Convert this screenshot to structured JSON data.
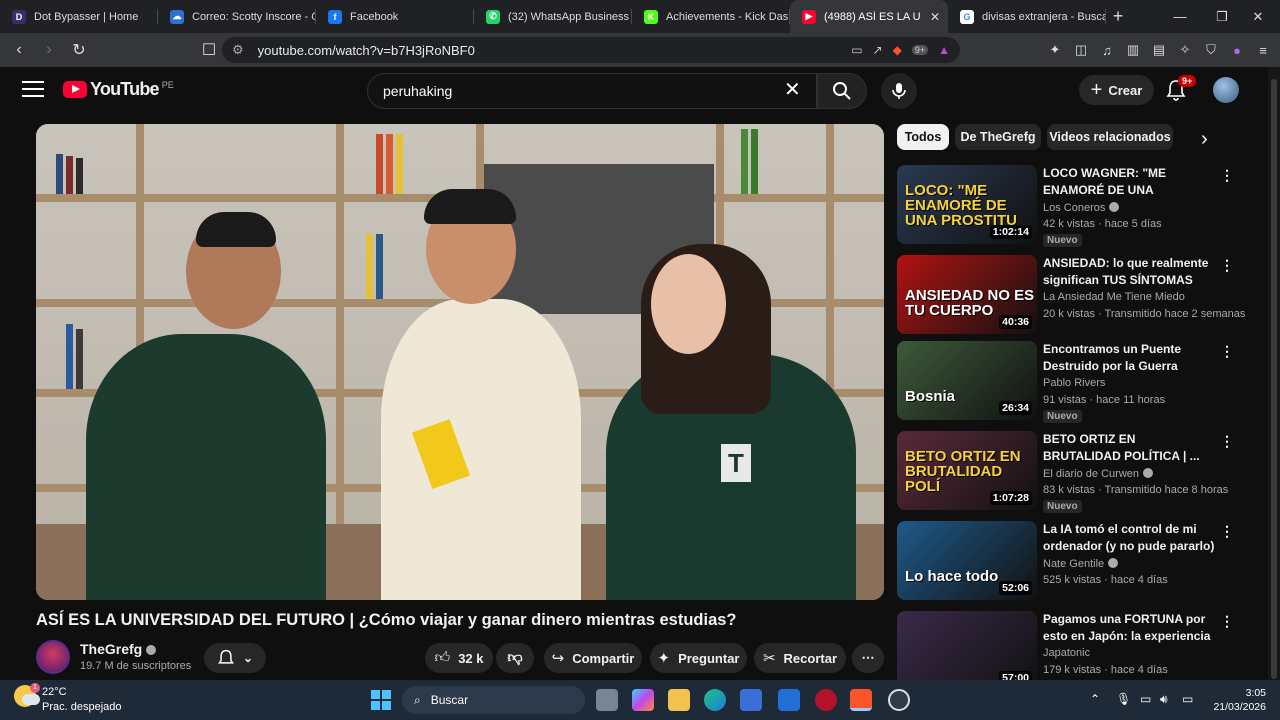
{
  "browser": {
    "tabs": [
      {
        "label": "Dot Bypasser | Home",
        "color": "#3b2f6b",
        "glyph": "D"
      },
      {
        "label": "Correo: Scotty Inscore - O",
        "color": "#2f6fd6",
        "glyph": "☁"
      },
      {
        "label": "Facebook",
        "color": "#1877f2",
        "glyph": "f"
      },
      {
        "label": "(32) WhatsApp Business",
        "color": "#25d366",
        "glyph": "✆"
      },
      {
        "label": "Achievements - Kick Dashb",
        "color": "#53fc18",
        "glyph": "K"
      },
      {
        "label": "(4988) ASÍ ES LA U",
        "color": "#ff0033",
        "glyph": "▶",
        "active": true
      },
      {
        "label": "divisas extranjera - Buscar",
        "color": "#ffffff",
        "glyph": "G"
      }
    ],
    "new_tab": "+",
    "url": "youtube.com/watch?v=b7H3jRoNBF0",
    "shield_badge": "9+"
  },
  "youtube": {
    "logo_text": "YouTube",
    "country_code": "PE",
    "search_value": "peruhaking",
    "create_label": "Crear",
    "notif_count": "9+"
  },
  "video": {
    "title": "ASÍ ES LA UNIVERSIDAD DEL FUTURO | ¿Cómo viajar y ganar dinero mientras estudias?",
    "channel": "TheGrefg",
    "subscribers": "19.7 M de suscriptores",
    "likes": "32 k",
    "share_label": "Compartir",
    "ask_label": "Preguntar",
    "clip_label": "Recortar"
  },
  "chips": [
    "Todos",
    "De TheGrefg",
    "Videos relacionados"
  ],
  "related": [
    {
      "title": "LOCO WAGNER: \"ME ENAMORÉ DE UNA CARIÑOSA\" ¿ESTUVO ...",
      "channel": "Los Coneros",
      "verified": true,
      "meta": "42 k vistas · hace 5 días",
      "badge": "Nuevo",
      "duration": "1:02:14",
      "thumb_text": "LOCO: \"ME ENAMORÉ DE UNA PROSTITU",
      "bg": "#2a3a52",
      "accent": "#f5d23c"
    },
    {
      "title": "ANSIEDAD: lo que realmente significan TUS SÍNTOMAS",
      "channel": "La Ansiedad Me Tiene Miedo",
      "verified": false,
      "meta": "20 k vistas · Transmitido hace 2 semanas",
      "badge": "",
      "duration": "40:36",
      "thumb_text": "ANSIEDAD NO ES TU CUERPO",
      "bg": "#b31212",
      "accent": "#ffffff"
    },
    {
      "title": "Encontramos un Puente Destruido por la Guerra",
      "channel": "Pablo Rivers",
      "verified": false,
      "meta": "91 vistas · hace 11 horas",
      "badge": "Nuevo",
      "duration": "26:34",
      "thumb_text": "Bosnia",
      "bg": "#3d5a3a",
      "accent": "#ffffff"
    },
    {
      "title": "BETO ORTIZ EN BRUTALIDAD POLÍTICA | ...",
      "channel": "El diario de Curwen",
      "verified": true,
      "meta": "83 k vistas · Transmitido hace 8 horas",
      "badge": "Nuevo",
      "duration": "1:07:28",
      "thumb_text": "BETO ORTIZ EN BRUTALIDAD POLÍ",
      "bg": "#5a2a3a",
      "accent": "#f5d23c"
    },
    {
      "title": "La IA tomó el control de mi ordenador (y no pude pararlo)",
      "channel": "Nate Gentile",
      "verified": true,
      "meta": "525 k vistas · hace 4 días",
      "badge": "",
      "duration": "52:06",
      "thumb_text": "Lo hace todo",
      "bg": "#1e5a8a",
      "accent": "#ffffff"
    },
    {
      "title": "Pagamos una FORTUNA por esto en Japón: la experiencia ...",
      "channel": "Japatonic",
      "verified": false,
      "meta": "179 k vistas · hace 4 días",
      "badge": "",
      "duration": "57:00",
      "thumb_text": "",
      "bg": "#3a2a4a",
      "accent": "#ffffff"
    }
  ],
  "taskbar": {
    "temperature": "22°C",
    "weather": "Prac. despejado",
    "weather_badge": "1",
    "search_label": "Buscar",
    "time": "3:05",
    "date": "21/03/2026"
  }
}
